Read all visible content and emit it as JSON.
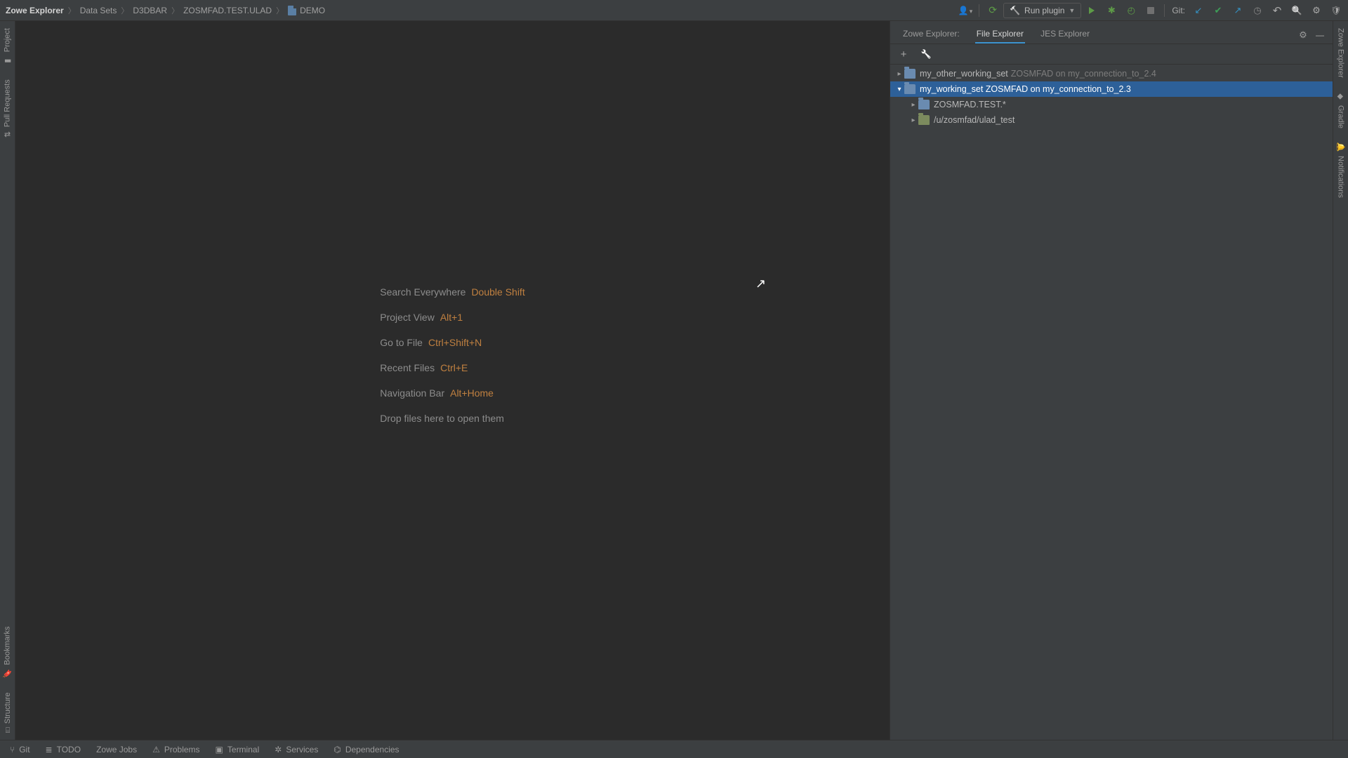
{
  "breadcrumb": {
    "root": "Zowe Explorer",
    "items": [
      "Data Sets",
      "D3DBAR",
      "ZOSMFAD.TEST.ULAD"
    ],
    "file": "DEMO"
  },
  "toolbar": {
    "run_label": "Run plugin",
    "git_label": "Git:"
  },
  "left_tabs": {
    "project": "Project",
    "pull_requests": "Pull Requests",
    "structure": "Structure",
    "bookmarks": "Bookmarks"
  },
  "right_tabs": {
    "zowe_explorer": "Zowe Explorer",
    "notifications": "Notifications",
    "gradle": "Gradle"
  },
  "editor_hints": {
    "search_label": "Search Everywhere",
    "search_key": "Double Shift",
    "project_label": "Project View",
    "project_key": "Alt+1",
    "gotofile_label": "Go to File",
    "gotofile_key": "Ctrl+Shift+N",
    "recent_label": "Recent Files",
    "recent_key": "Ctrl+E",
    "nav_label": "Navigation Bar",
    "nav_key": "Alt+Home",
    "drop_label": "Drop files here to open them"
  },
  "panel": {
    "tabs": {
      "zowe": "Zowe Explorer:",
      "file": "File Explorer",
      "jes": "JES Explorer"
    }
  },
  "tree": {
    "nodes": [
      {
        "depth": 0,
        "name": "my_other_working_set",
        "suffix": "ZOSMFAD on my_connection_to_2.4",
        "expanded": false,
        "selected": false,
        "dim_suffix": true
      },
      {
        "depth": 0,
        "name": "my_working_set ZOSMFAD on my_connection_to_2.3",
        "suffix": "",
        "expanded": true,
        "selected": true,
        "dim_suffix": false
      },
      {
        "depth": 1,
        "name": "ZOSMFAD.TEST.*",
        "suffix": "",
        "expanded": false,
        "selected": false,
        "alt": false
      },
      {
        "depth": 1,
        "name": "/u/zosmfad/ulad_test",
        "suffix": "",
        "expanded": false,
        "selected": false,
        "alt": true
      }
    ]
  },
  "bottom": {
    "git": "Git",
    "todo": "TODO",
    "zowe_jobs": "Zowe Jobs",
    "problems": "Problems",
    "terminal": "Terminal",
    "services": "Services",
    "dependencies": "Dependencies"
  }
}
